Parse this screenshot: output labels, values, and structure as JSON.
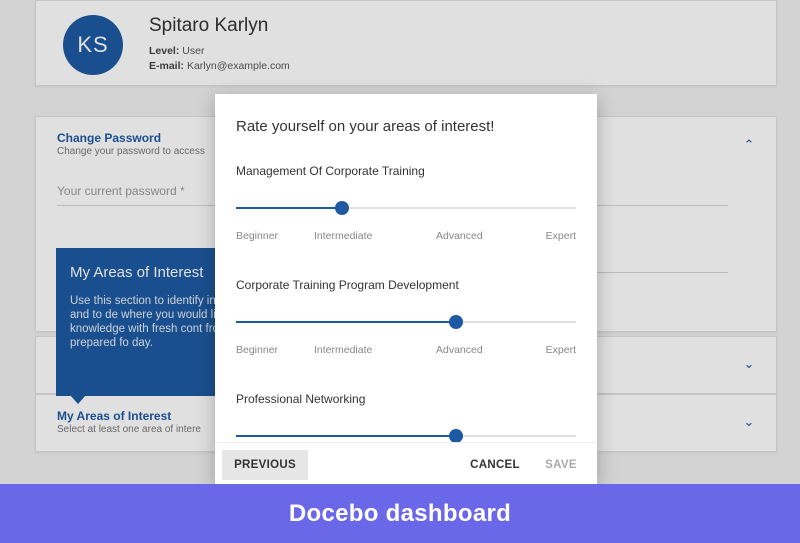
{
  "profile": {
    "initials": "KS",
    "name": "Spitaro Karlyn",
    "level_label": "Level:",
    "level_value": "User",
    "email_label": "E-mail:",
    "email_value": "Karlyn@example.com"
  },
  "password_section": {
    "title": "Change Password",
    "subtitle": "Change your password to access",
    "current_password_placeholder": "Your current password *"
  },
  "tooltip": {
    "title": "My Areas of Interest",
    "body": "Use this section to identify in the company and to de where you would like to in knowledge with fresh cont from the web, prepared fo day."
  },
  "areas_section": {
    "title": "My Areas of Interest",
    "subtitle": "Select at least one area of intere"
  },
  "modal": {
    "title": "Rate yourself on your areas of interest!",
    "levels": [
      "Beginner",
      "Intermediate",
      "Advanced",
      "Expert"
    ],
    "questions": [
      {
        "label": "Management Of Corporate Training",
        "level_fraction": 0.313
      },
      {
        "label": "Corporate Training Program Development",
        "level_fraction": 0.647
      },
      {
        "label": "Professional Networking",
        "level_fraction": 0.647
      }
    ],
    "buttons": {
      "previous": "PREVIOUS",
      "cancel": "CANCEL",
      "save": "SAVE"
    }
  },
  "banner": {
    "text": "Docebo dashboard"
  },
  "colors": {
    "accent": "#1e5aa3",
    "banner": "#6a67e8"
  }
}
